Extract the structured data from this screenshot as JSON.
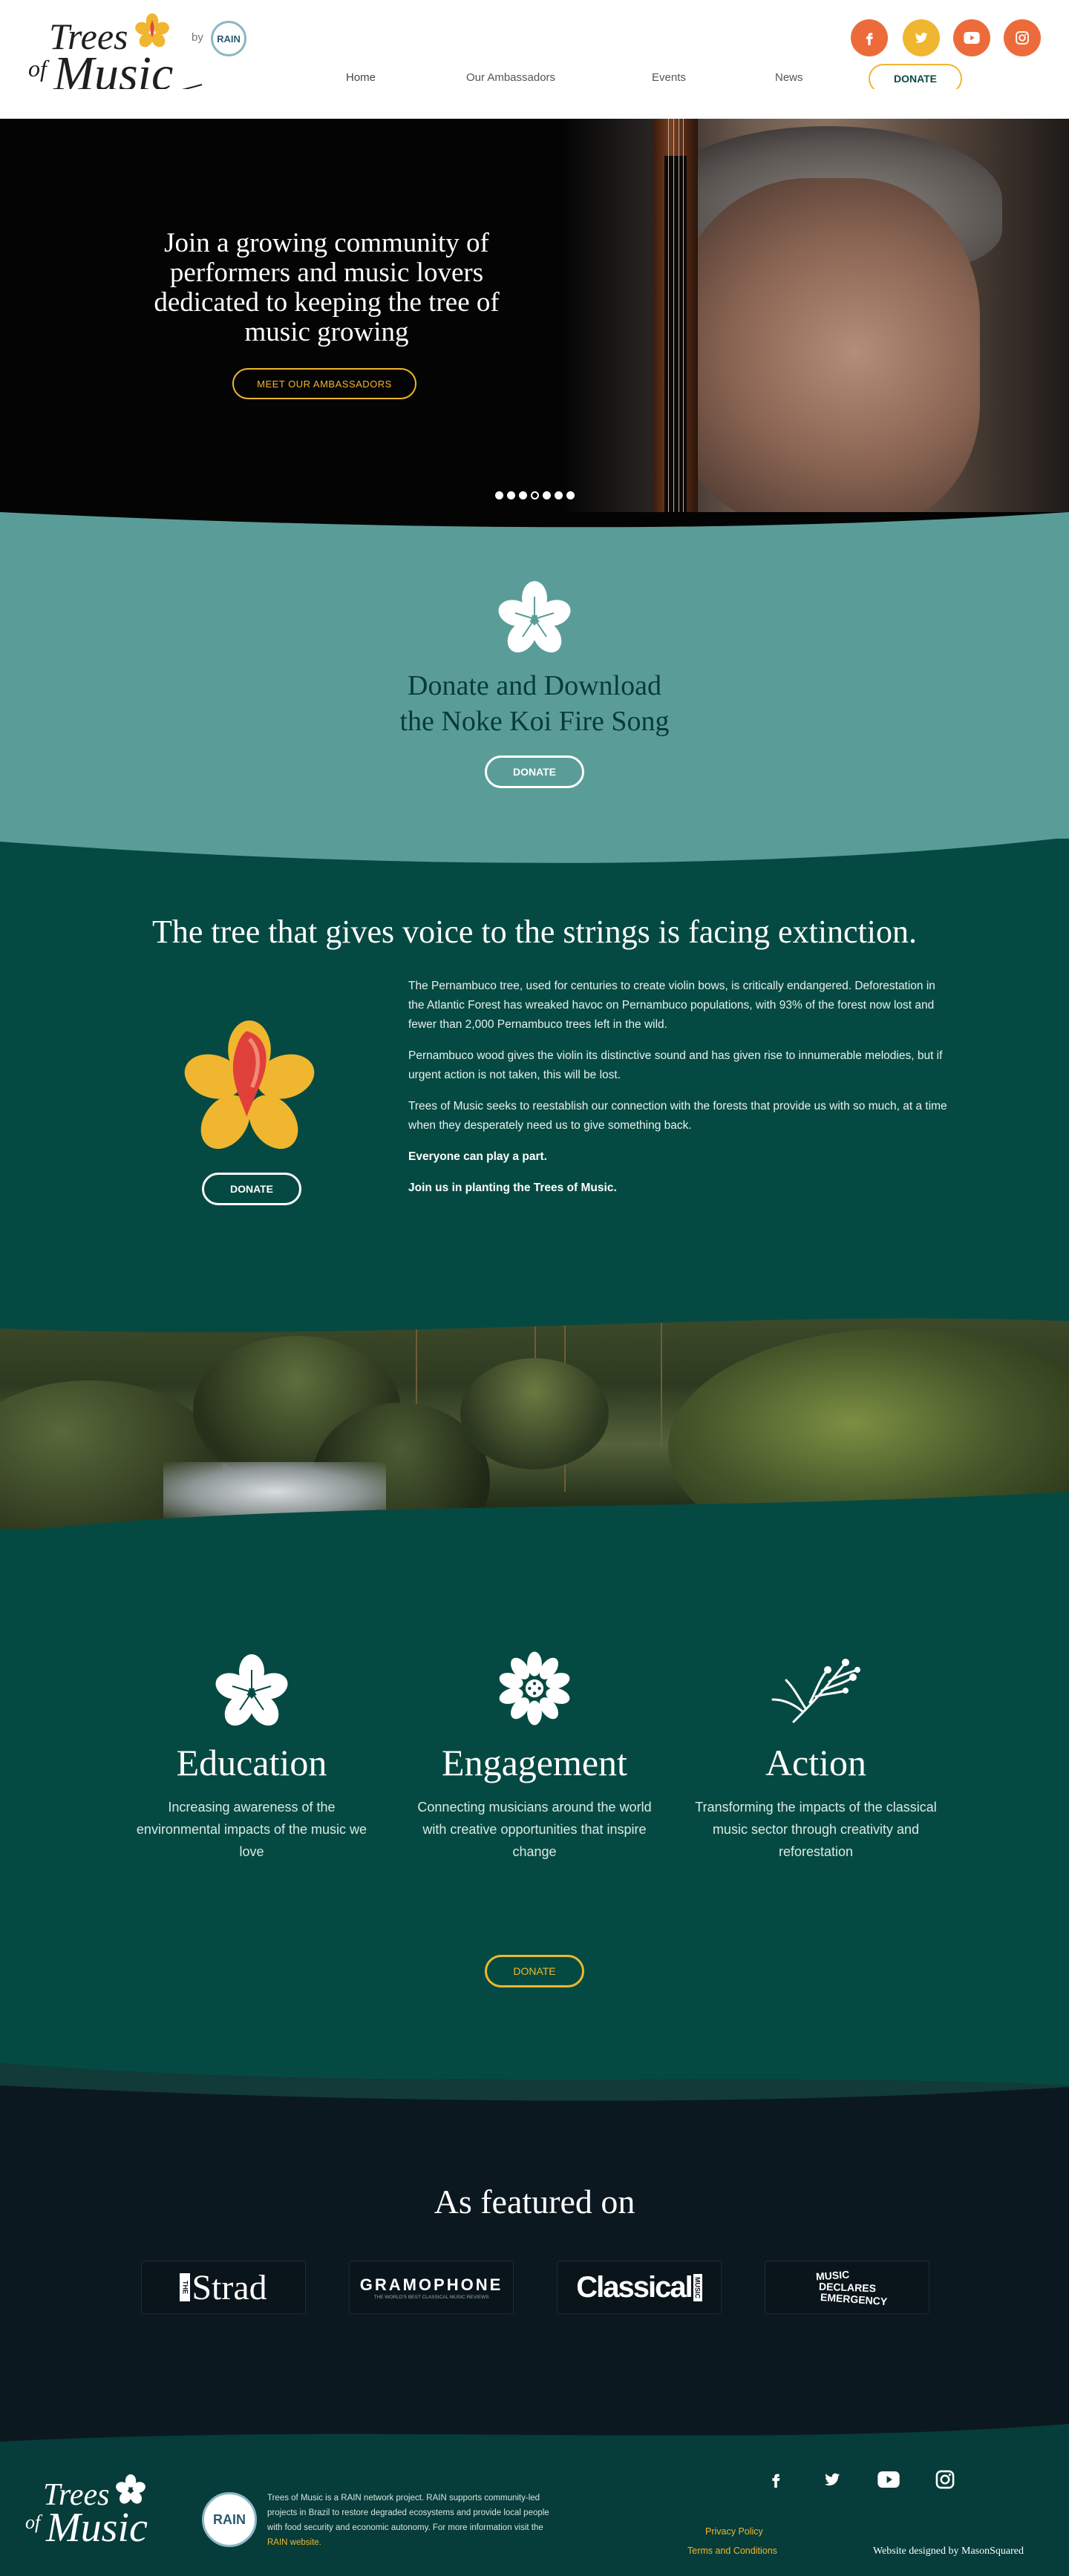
{
  "brand": {
    "logo_word1": "Trees",
    "logo_word2": "of",
    "logo_word3": "Music",
    "by": "by",
    "rain": "RAIN"
  },
  "nav": {
    "items": [
      "Home",
      "Our Ambassadors",
      "Events",
      "News"
    ],
    "donate": "DONATE"
  },
  "social": [
    "facebook-icon",
    "twitter-icon",
    "youtube-icon",
    "instagram-icon"
  ],
  "colors": {
    "accent_yellow": "#f0b62f",
    "social_orange": "#ed6b3b",
    "social_yellow": "#f0b62f",
    "teal": "#5a9d98",
    "dark_green": "#054a42",
    "navy": "#0c1820"
  },
  "hero": {
    "title": "Join a growing community of performers and music lovers dedicated to keeping the tree of music growing",
    "button": "MEET OUR AMBASSADORS",
    "slide_count": 7,
    "active_slide": 4
  },
  "teal_section": {
    "title_line1": "Donate and Download",
    "title_line2": "the Noke Koi Fire Song",
    "button": "DONATE"
  },
  "info": {
    "title": "The tree that gives voice to the strings is facing extinction.",
    "donate": "DONATE",
    "p1": "The Pernambuco tree, used for centuries to create violin bows, is critically endangered. Deforestation in the Atlantic Forest has wreaked havoc on Pernambuco populations, with 93% of the forest now lost and fewer than 2,000 Pernambuco trees left in the wild.",
    "p2": "Pernambuco wood gives the violin its distinctive sound and has given rise to innumerable melodies, but if urgent action is not taken, this will be lost.",
    "p3": "Trees of Music seeks to reestablish our connection with the forests that provide us with so much, at a time when they desperately need us to give something back.",
    "p4": "Everyone can play a part.",
    "p5": "Join us in planting the Trees of Music."
  },
  "pillars": [
    {
      "title": "Education",
      "text": "Increasing awareness of the environmental impacts of the music we love"
    },
    {
      "title": "Engagement",
      "text": "Connecting musicians around the world with creative opportunities that inspire change"
    },
    {
      "title": "Action",
      "text": "Transforming the impacts of the classical music sector through creativity and reforestation"
    }
  ],
  "pillars_donate": "DONATE",
  "featured": {
    "title": "As featured on",
    "logos": {
      "strad_the": "THE",
      "strad": "Strad",
      "gramophone": "GRAMOPHONE",
      "gramophone_tag": "THE WORLD'S BEST CLASSICAL MUSIC REVIEWS",
      "classical": "Classical",
      "classical_side": "MUSIC",
      "mde1": "MUSIC",
      "mde2": "DECLARES",
      "mde3": "EMERGENCY"
    }
  },
  "footer": {
    "text_main": "Trees of Music is a RAIN network project. RAIN supports community-led projects in Brazil to restore degraded ecosystems and provide local people with food security and economic autonomy. For more information visit the",
    "text_link": "RAIN website.",
    "privacy": "Privacy Policy",
    "terms": "Terms and Conditions",
    "credit": "Website designed by MasonSquared"
  }
}
